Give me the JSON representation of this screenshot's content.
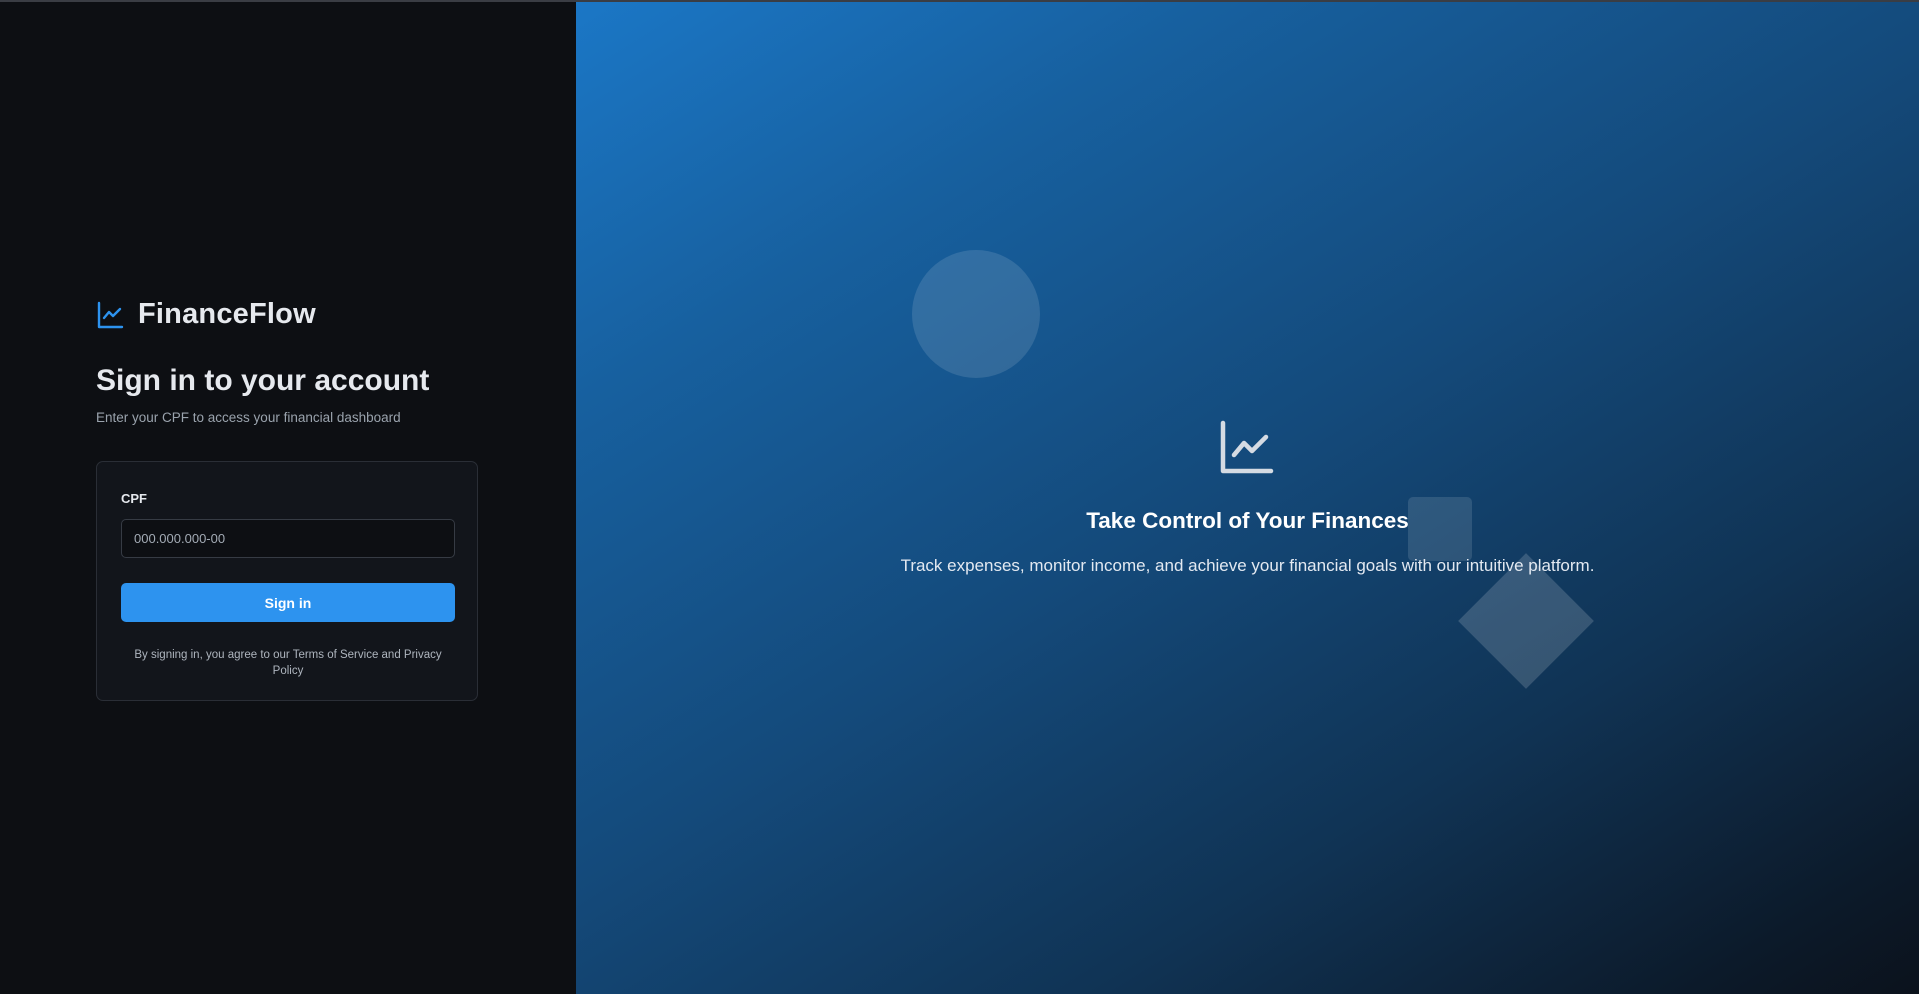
{
  "brand": {
    "name": "FinanceFlow",
    "icon": "line-chart-icon",
    "accent_color": "#2d93ef"
  },
  "signin": {
    "title": "Sign in to your account",
    "subtitle": "Enter your CPF to access your financial dashboard"
  },
  "form": {
    "cpf_label": "CPF",
    "cpf_value": "",
    "cpf_placeholder": "000.000.000-00",
    "submit_label": "Sign in",
    "terms": "By signing in, you agree to our Terms of Service and Privacy Policy"
  },
  "hero": {
    "icon": "line-chart-icon",
    "title": "Take Control of Your Finances",
    "text": "Track expenses, monitor income, and achieve your financial goals with our intuitive platform."
  }
}
